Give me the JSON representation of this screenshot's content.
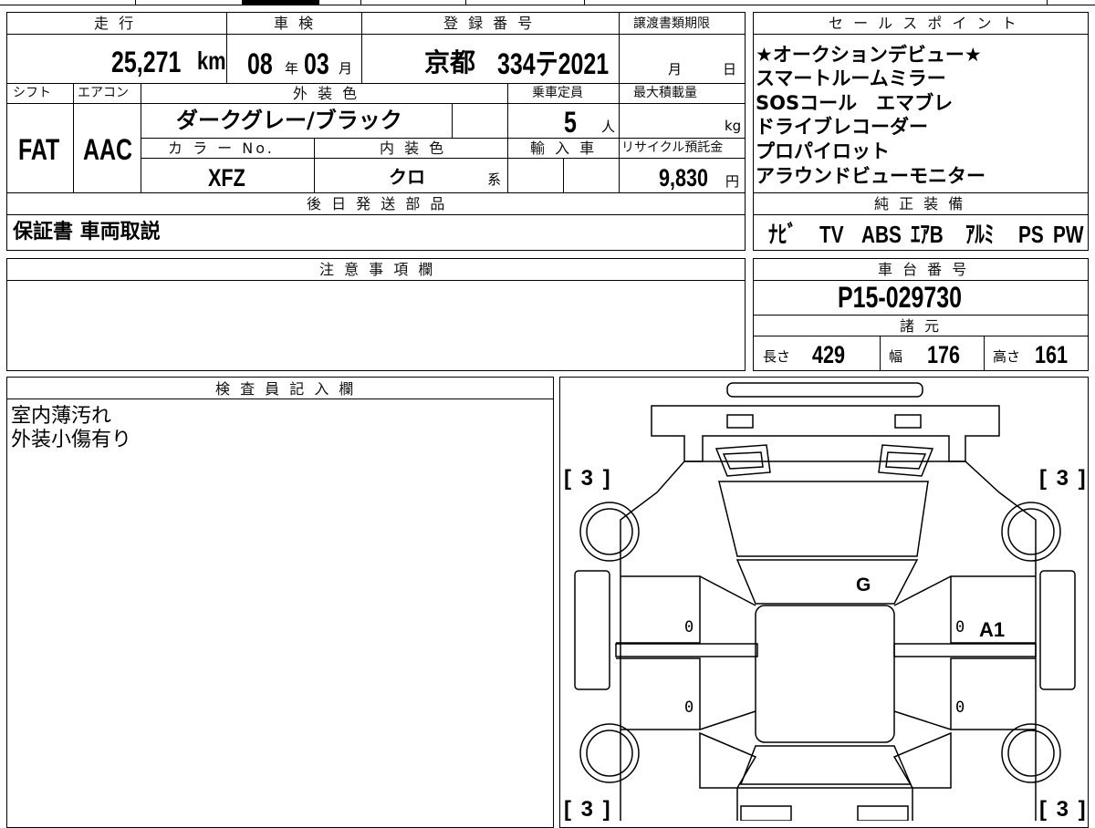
{
  "top_form": {
    "labels": {
      "mileage": "走 行",
      "inspection": "車 検",
      "registration": "登 録 番 号",
      "transfer_deadline": "譲渡書類期限",
      "shift": "シフト",
      "aircon": "エアコン",
      "exterior_color": "外 装 色",
      "capacity": "乗車定員",
      "max_load": "最大積載量",
      "color_no": "カ ラ ー No.",
      "interior_color": "内 装 色",
      "import": "輸 入 車",
      "recycle_fee": "リサイクル預託金",
      "later_parts": "後 日 発 送 部 品"
    },
    "values": {
      "mileage": "25,271",
      "mileage_unit": "km",
      "inspection_year": "08",
      "year_unit": "年",
      "inspection_month": "03",
      "month_unit": "月",
      "registration_region": "京都",
      "registration_number": "334テ2021",
      "transfer_month_unit": "月",
      "transfer_day_unit": "日",
      "shift": "FAT",
      "aircon": "AAC",
      "exterior_color": "ダークグレー/ブラック",
      "capacity": "5",
      "capacity_unit": "人",
      "max_load_unit": "kg",
      "color_no": "XFZ",
      "interior_color": "クロ",
      "interior_suffix": "系",
      "recycle_fee": "9,830",
      "recycle_unit": "円",
      "later_parts": "保証書 車両取説"
    }
  },
  "sales_points": {
    "header": "セ ー ル ス ポ イ ン ト",
    "items": [
      "★オークションデビュー★",
      "スマートルームミラー",
      "SOSコール　エマブレ",
      "ドライブレコーダー",
      "プロパイロット",
      "アラウンドビューモニター"
    ]
  },
  "equipment": {
    "header": "純 正 装 備",
    "items": [
      "ﾅﾋﾞ",
      "TV",
      "ABS",
      "ｴｱB",
      "ｱﾙﾐ",
      "PS",
      "PW"
    ]
  },
  "notes": {
    "header": "注 意 事 項 欄",
    "text": ""
  },
  "chassis": {
    "header": "車 台 番 号",
    "number": "P15-029730",
    "spec_header": "諸 元",
    "length_label": "長さ",
    "length": "429",
    "width_label": "幅",
    "width": "176",
    "height_label": "高さ",
    "height": "161"
  },
  "inspector": {
    "header": "検 査 員 記 入 欄",
    "lines": [
      "室内薄汚れ",
      "外装小傷有り"
    ]
  },
  "diagram": {
    "tire_front_left": "[ 3 ]",
    "tire_front_right": "[ 3 ]",
    "tire_rear_left": "[ 3 ]",
    "tire_rear_right": "[ 3 ]",
    "windshield_mark": "G",
    "right_front_door_mark": "A1",
    "panel_lf": "0",
    "panel_lr": "0",
    "panel_rf": "0",
    "panel_rr": "0"
  }
}
